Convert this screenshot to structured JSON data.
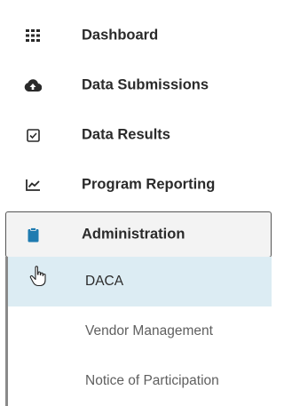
{
  "nav": {
    "items": [
      {
        "label": "Dashboard",
        "icon": "grid-icon"
      },
      {
        "label": "Data Submissions",
        "icon": "cloud-upload-icon"
      },
      {
        "label": "Data Results",
        "icon": "checkbox-icon"
      },
      {
        "label": "Program Reporting",
        "icon": "line-chart-icon"
      },
      {
        "label": "Administration",
        "icon": "clipboard-icon"
      }
    ],
    "submenu": [
      {
        "label": "DACA"
      },
      {
        "label": "Vendor Management"
      },
      {
        "label": "Notice of Participation"
      }
    ],
    "colors": {
      "accent": "#1f7bb0",
      "selected_bg": "#dcecf3",
      "active_bg": "#f3f3f3"
    }
  }
}
